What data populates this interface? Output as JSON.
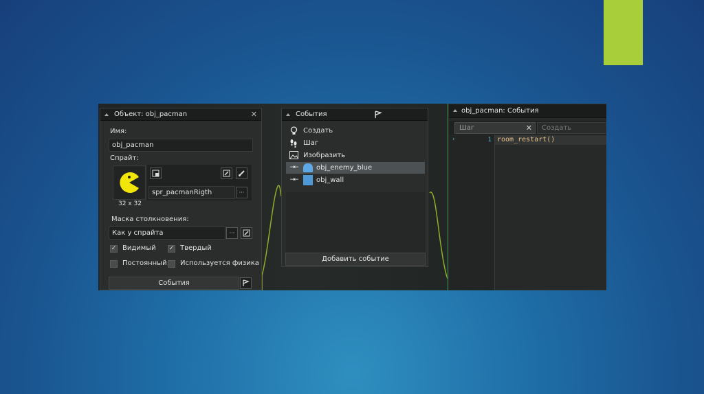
{
  "slide": {
    "accent_color": "#a8cf3a"
  },
  "object_panel": {
    "title": "Объект: obj_pacman",
    "close": "✕",
    "name_label": "Имя:",
    "name_value": "obj_pacman",
    "sprite_label": "Спрайт:",
    "sprite_name": "spr_pacmanRigth",
    "sprite_size": "32 x 32",
    "more": "···",
    "mask_label": "Маска столкновения:",
    "mask_value": "Как у спрайта",
    "checkboxes": [
      {
        "label": "Видимый",
        "checked": true
      },
      {
        "label": "Твердый",
        "checked": true
      },
      {
        "label": "Постоянный",
        "checked": false
      },
      {
        "label": "Используется физика",
        "checked": false
      }
    ],
    "events_button": "События"
  },
  "events_panel": {
    "title": "События",
    "items": [
      {
        "icon": "lightbulb-icon",
        "label": "Создать"
      },
      {
        "icon": "footsteps-icon",
        "label": "Шаг"
      },
      {
        "icon": "picture-icon",
        "label": "Изобразить"
      },
      {
        "icon": "collision-icon",
        "label": "obj_enemy_blue",
        "selected": true
      },
      {
        "icon": "collision-icon",
        "label": "obj_wall"
      }
    ],
    "add_button": "Добавить событие"
  },
  "code_panel": {
    "title": "obj_pacman: События",
    "tab_active": "Шаг",
    "tab_inactive": "Создать",
    "line_number": "1",
    "code": "room_restart()"
  }
}
